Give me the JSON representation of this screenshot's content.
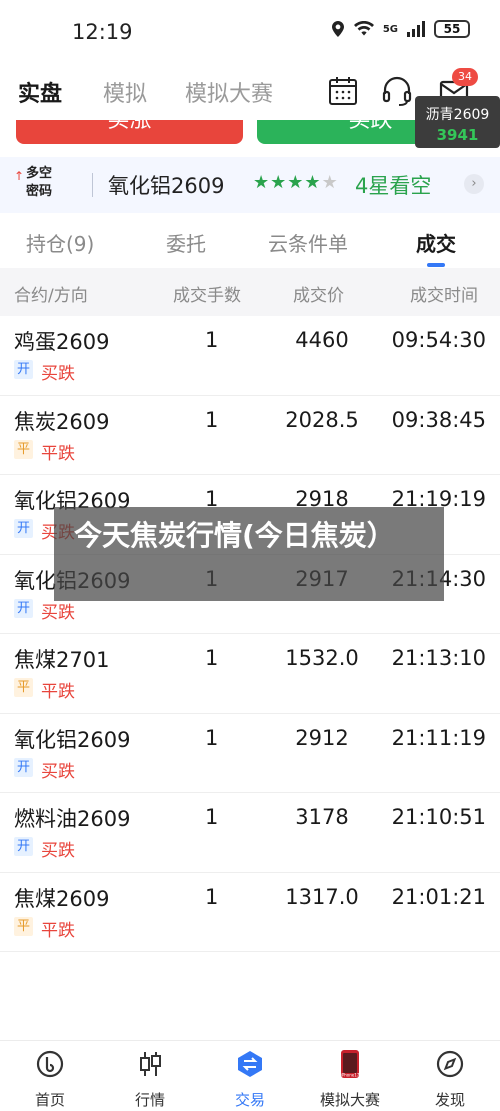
{
  "status_bar": {
    "time": "12:19",
    "network": "5G",
    "battery": "55"
  },
  "header": {
    "tabs": [
      {
        "label": "实盘",
        "active": true
      },
      {
        "label": "模拟",
        "active": false
      },
      {
        "label": "模拟大赛",
        "active": false
      }
    ],
    "icons": [
      "calendar-icon",
      "headset-icon",
      "mail-icon"
    ],
    "mail_badge": "34"
  },
  "ticker": {
    "name": "沥青2609",
    "price": "3941",
    "price_color": "#34c759"
  },
  "actions": {
    "buy_label": "买涨",
    "sell_label": "买跌"
  },
  "banner": {
    "logo_line1": "多空",
    "logo_line2": "密码",
    "contract": "氧化铝2609",
    "stars_on": 4,
    "stars_total": 5,
    "rating_text": "4星看空"
  },
  "sub_tabs": [
    {
      "label": "持仓(9)",
      "active": false
    },
    {
      "label": "委托",
      "active": false
    },
    {
      "label": "云条件单",
      "active": false
    },
    {
      "label": "成交",
      "active": true
    }
  ],
  "table": {
    "headers": [
      "合约/方向",
      "成交手数",
      "成交价",
      "成交时间"
    ],
    "rows": [
      {
        "contract": "鸡蛋2609",
        "tag": "开",
        "tag_type": "open",
        "direction": "买跌",
        "lots": "1",
        "price": "4460",
        "time": "09:54:30"
      },
      {
        "contract": "焦炭2609",
        "tag": "平",
        "tag_type": "close",
        "direction": "平跌",
        "lots": "1",
        "price": "2028.5",
        "time": "09:38:45"
      },
      {
        "contract": "氧化铝2609",
        "tag": "开",
        "tag_type": "open",
        "direction": "买跌",
        "lots": "1",
        "price": "2918",
        "time": "21:19:19"
      },
      {
        "contract": "氧化铝2609",
        "tag": "开",
        "tag_type": "open",
        "direction": "买跌",
        "lots": "1",
        "price": "2917",
        "time": "21:14:30"
      },
      {
        "contract": "焦煤2701",
        "tag": "平",
        "tag_type": "close",
        "direction": "平跌",
        "lots": "1",
        "price": "1532.0",
        "time": "21:13:10"
      },
      {
        "contract": "氧化铝2609",
        "tag": "开",
        "tag_type": "open",
        "direction": "买跌",
        "lots": "1",
        "price": "2912",
        "time": "21:11:19"
      },
      {
        "contract": "燃料油2609",
        "tag": "开",
        "tag_type": "open",
        "direction": "买跌",
        "lots": "1",
        "price": "3178",
        "time": "21:10:51"
      },
      {
        "contract": "焦煤2609",
        "tag": "平",
        "tag_type": "close",
        "direction": "平跌",
        "lots": "1",
        "price": "1317.0",
        "time": "21:01:21"
      }
    ]
  },
  "overlay": {
    "text": "今天焦炭行情(今日焦炭）"
  },
  "bottom_nav": [
    {
      "label": "首页",
      "icon": "home-icon",
      "active": false
    },
    {
      "label": "行情",
      "icon": "candlestick-icon",
      "active": false
    },
    {
      "label": "交易",
      "icon": "trade-icon",
      "active": true
    },
    {
      "label": "模拟大赛",
      "icon": "contest-icon",
      "active": false,
      "icon_text": "iPhone17"
    },
    {
      "label": "发现",
      "icon": "compass-icon",
      "active": false
    }
  ],
  "colors": {
    "accent": "#3478f6",
    "up": "#e8453c",
    "down": "#2bb35a"
  }
}
